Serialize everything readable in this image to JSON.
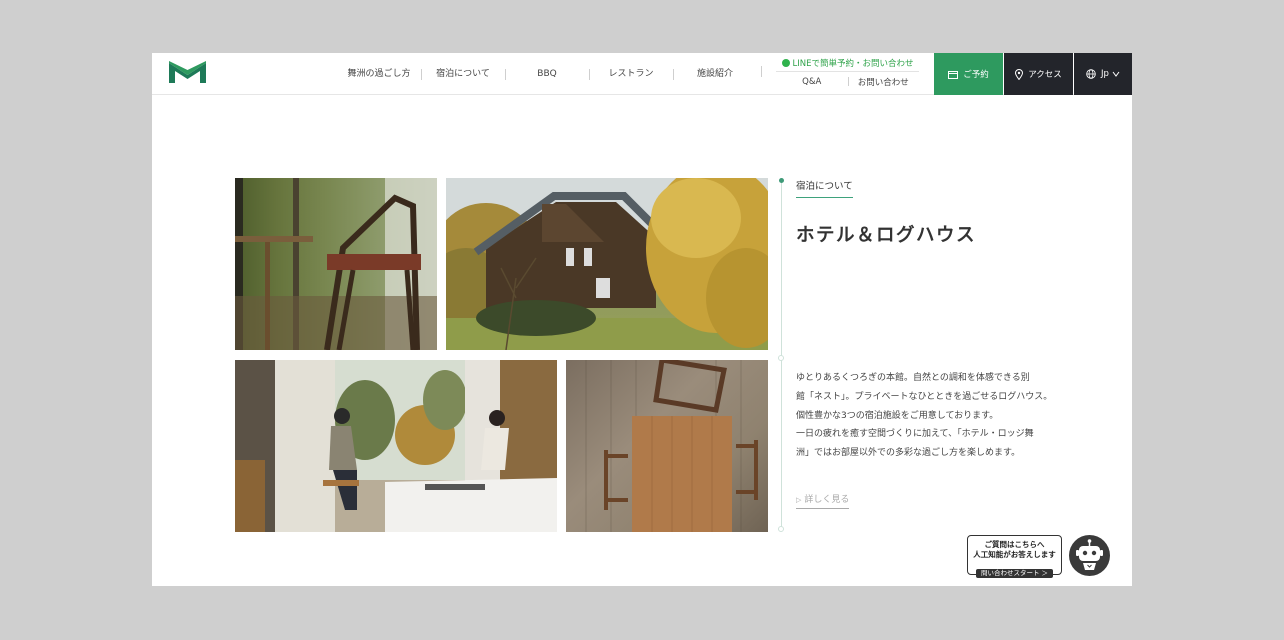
{
  "header": {
    "nav": [
      "舞洲の過ごし方",
      "宿泊について",
      "BBQ",
      "レストラン",
      "施設紹介"
    ],
    "line_link": "LINEで簡単予約・お問い合わせ",
    "sub_links": [
      "Q&A",
      "お問い合わせ"
    ],
    "reserve_label": "ご予約",
    "access_label": "アクセス",
    "lang_label": "Jp"
  },
  "main": {
    "section_label": "宿泊について",
    "title": "ホテル＆ログハウス",
    "description": [
      "ゆとりあるくつろぎの本館。自然との調和を体感できる別",
      "館「ネスト」。プライベートなひとときを過ごせるログハウス。",
      "個性豊かな3つの宿泊施設をご用意しております。",
      "一日の疲れを癒す空間づくりに加えて、「ホテル・ロッジ舞",
      "洲」ではお部屋以外での多彩な過ごし方を楽しめます。"
    ],
    "more_link": "詳しく見る"
  },
  "chatbot": {
    "line1": "ご質問はこちらへ",
    "line2": "人工知能がお答えします",
    "button": "問い合わせスタート ＞"
  },
  "colors": {
    "brand_green": "#2e9a5f",
    "dark_button": "#23252b",
    "line_green": "#2fb24c"
  }
}
